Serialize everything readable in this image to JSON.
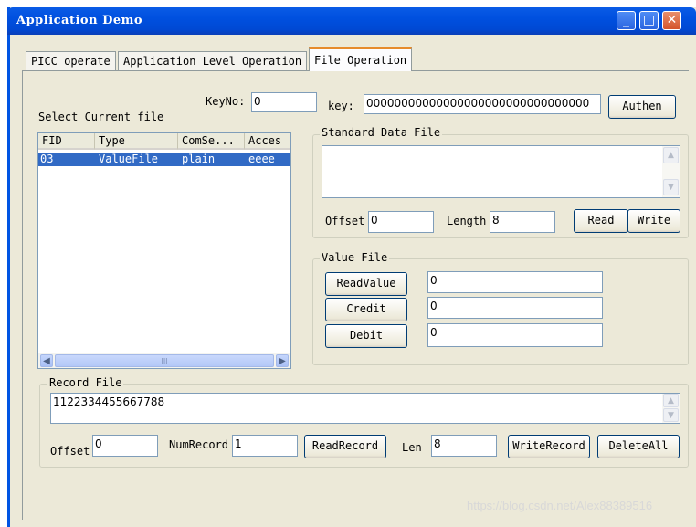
{
  "window": {
    "title": "Application Demo"
  },
  "tabs": [
    "PICC operate",
    "Application Level Operation",
    "File Operation"
  ],
  "auth": {
    "keyno_label": "KeyNo:",
    "keyno_value": "0",
    "key_label": "key:",
    "key_value": "00000000000000000000000000000000",
    "authen_label": "Authen"
  },
  "file_list": {
    "title": "Select Current file",
    "columns": [
      "FID",
      "Type",
      "ComSe...",
      "Acces"
    ],
    "rows": [
      {
        "fid": "03",
        "type": "ValueFile",
        "comse": "plain",
        "access": "eeee",
        "selected": true
      }
    ],
    "scroll_grip": "III"
  },
  "standard_data_file": {
    "title": "Standard Data File",
    "content": "",
    "offset_label": "Offset",
    "offset_value": "0",
    "length_label": "Length",
    "length_value": "8",
    "read_label": "Read",
    "write_label": "Write"
  },
  "value_file": {
    "title": "Value File",
    "readvalue_label": "ReadValue",
    "readvalue_value": "0",
    "credit_label": "Credit",
    "credit_value": "0",
    "debit_label": "Debit",
    "debit_value": "0"
  },
  "record_file": {
    "title": "Record File",
    "content": "1122334455667788",
    "offset_label": "Offset",
    "offset_value": "0",
    "numrecord_label": "NumRecord",
    "numrecord_value": "1",
    "readrecord_label": "ReadRecord",
    "len_label": "Len",
    "len_value": "8",
    "writerecord_label": "WriteRecord",
    "deleteall_label": "DeleteAll"
  },
  "watermark": "https://blog.csdn.net/Alex88389516",
  "colors": {
    "titlebar": "#0054e3",
    "selection": "#316ac5",
    "face": "#ece9d8",
    "close": "#d5542b"
  }
}
